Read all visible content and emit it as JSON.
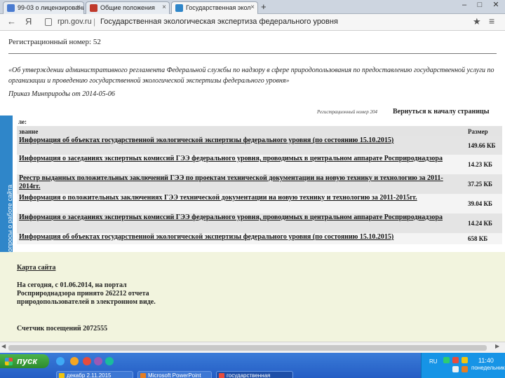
{
  "browser": {
    "tabs": [
      {
        "label": "99-03 о лицензировани",
        "icon_color": "#4a7bd0",
        "active": false
      },
      {
        "label": "Общие положения",
        "icon_color": "#c0392b",
        "active": false
      },
      {
        "label": "Государственная экол",
        "icon_color": "#2f86c9",
        "active": true
      }
    ],
    "new_tab": "+",
    "window_controls": [
      "–",
      "□",
      "✕"
    ],
    "nav": {
      "back": "←",
      "reload": "Я"
    },
    "url_domain": "rpn.gov.ru",
    "url_separator": "|",
    "url_title": "Государственная экологическая экспертиза федерального уровня",
    "star": "★",
    "menu": "≡"
  },
  "page": {
    "registration_number": "Регистрационный номер: 52",
    "document_title": "«Об утверждении административного регламента Федеральной службы по надзору в сфере природопользования по предоставлению государственной услуги по организации и проведению государственной экологической экспертизы федерального уровня»",
    "order": "Приказ Минприроды от 2014-05-06",
    "side_tab_label": "Остались вопросы о работе сайта",
    "registration_label": "Регистрационный номер 204",
    "back_to_top": "Вернуться к началу страницы",
    "files_label": "ле:",
    "table": {
      "headers": {
        "name": "звание",
        "size": "Размер"
      },
      "rows": [
        {
          "name": "Информация об объектах государственной экологической экспертизы федерального уровня (по состоянию 15.10.2015)",
          "size": "149.66 КБ",
          "shade": "dark"
        },
        {
          "name": "Информация о заседаниях экспертных комиссий ГЭЭ федерального уровня, проводимых в центральном аппарате Росприроднадзора",
          "size": "14.23 КБ",
          "shade": "light"
        },
        {
          "name": "Реестр выданных положительных заключений ГЭЭ по проектам технической документации на новую технику и технологию за 2011-2014гг.",
          "size": "37.25 КБ",
          "shade": "dark"
        },
        {
          "name": "Информация о положительных заключениях ГЭЭ технической документации на новую технику и технологию за 2011-2015гг.",
          "size": "39.04 КБ",
          "shade": "light"
        },
        {
          "name": "Информация о заседаниях экспертных комиссий ГЭЭ федерального уровня, проводимых в центральном аппарате Росприроднадзора",
          "size": "14.24 КБ",
          "shade": "dark"
        },
        {
          "name": "Информация об объектах государственной экологической экспертизы федерального уровня (по состоянию 15.10.2015)",
          "size": "658 КБ",
          "shade": "light"
        }
      ]
    },
    "sitemap": "Карта сайта",
    "stats": "На сегодня, с 01.06.2014, на портал Росприроднадзора принято 262212 отчета природопользователей в электронном виде.",
    "counter": "Счетчик посещений 2072555"
  },
  "scrollbar": {
    "left": "◀",
    "right": "▶"
  },
  "taskbar": {
    "start_label": "пуск",
    "buttons": [
      {
        "label": "декабр 2.11.2015",
        "icon_color": "#f1c40f",
        "active": false
      },
      {
        "label": "Microsoft PowerPoint",
        "icon_color": "#e67e22",
        "active": false
      },
      {
        "label": "государственная",
        "icon_color": "#e74c3c",
        "active": true
      }
    ],
    "language": "RU",
    "clock": "11:40",
    "day": "понедельник"
  }
}
